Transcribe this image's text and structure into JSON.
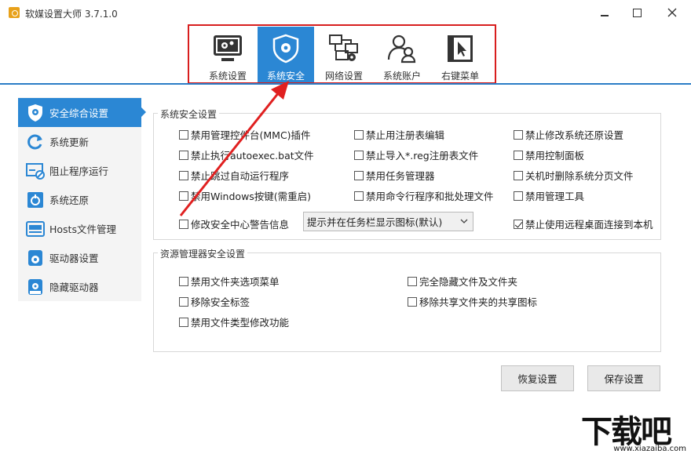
{
  "window": {
    "title": "软媒设置大师 3.7.1.0",
    "controls": [
      "minimize-icon",
      "maximize-icon",
      "close-icon"
    ]
  },
  "toolbar": {
    "tabs": [
      {
        "label": "系统设置",
        "icon": "system-settings-icon",
        "active": false
      },
      {
        "label": "系统安全",
        "icon": "shield-gear-icon",
        "active": true
      },
      {
        "label": "网络设置",
        "icon": "network-icon",
        "active": false
      },
      {
        "label": "系统账户",
        "icon": "users-icon",
        "active": false
      },
      {
        "label": "右键菜单",
        "icon": "cursor-menu-icon",
        "active": false
      }
    ],
    "accent": "#2b87d4",
    "highlight_color": "#d81e1e"
  },
  "sidebar": {
    "items": [
      {
        "label": "安全综合设置",
        "icon": "shield-icon",
        "active": true
      },
      {
        "label": "系统更新",
        "icon": "refresh-icon",
        "active": false
      },
      {
        "label": "阻止程序运行",
        "icon": "block-program-icon",
        "active": false
      },
      {
        "label": "系统还原",
        "icon": "restore-icon",
        "active": false
      },
      {
        "label": "Hosts文件管理",
        "icon": "hosts-icon",
        "active": false
      },
      {
        "label": "驱动器设置",
        "icon": "drive-icon",
        "active": false
      },
      {
        "label": "隐藏驱动器",
        "icon": "hide-drive-icon",
        "active": false
      }
    ]
  },
  "security": {
    "title": "系统安全设置",
    "col1": [
      {
        "label": "禁用管理控件台(MMC)插件",
        "checked": false
      },
      {
        "label": "禁止执行autoexec.bat文件",
        "checked": false
      },
      {
        "label": "禁止跳过自动运行程序",
        "checked": false
      },
      {
        "label": "禁用Windows按键(需重启)",
        "checked": false
      }
    ],
    "col2": [
      {
        "label": "禁止用注册表编辑",
        "checked": false
      },
      {
        "label": "禁止导入*.reg注册表文件",
        "checked": false
      },
      {
        "label": "禁用任务管理器",
        "checked": false
      },
      {
        "label": "禁用命令行程序和批处理文件",
        "checked": false
      }
    ],
    "col3": [
      {
        "label": "禁止修改系统还原设置",
        "checked": false
      },
      {
        "label": "禁用控制面板",
        "checked": false
      },
      {
        "label": "关机时删除系统分页文件",
        "checked": false
      },
      {
        "label": "禁用管理工具",
        "checked": false
      }
    ],
    "security_center": {
      "label": "修改安全中心警告信息",
      "checked": false
    },
    "notify_select": "提示并在任务栏显示图标(默认)",
    "remote_desktop": {
      "label": "禁止使用远程桌面连接到本机",
      "checked": true
    }
  },
  "explorer": {
    "title": "资源管理器安全设置",
    "left": [
      {
        "label": "禁用文件夹选项菜单",
        "checked": false
      },
      {
        "label": "移除安全标签",
        "checked": false
      },
      {
        "label": "禁用文件类型修改功能",
        "checked": false
      }
    ],
    "right": [
      {
        "label": "完全隐藏文件及文件夹",
        "checked": false
      },
      {
        "label": "移除共享文件夹的共享图标",
        "checked": false
      }
    ]
  },
  "actions": {
    "restore": "恢复设置",
    "save": "保存设置"
  },
  "watermark": {
    "logo": "下载吧",
    "url": "www.xiazaiba.com"
  }
}
